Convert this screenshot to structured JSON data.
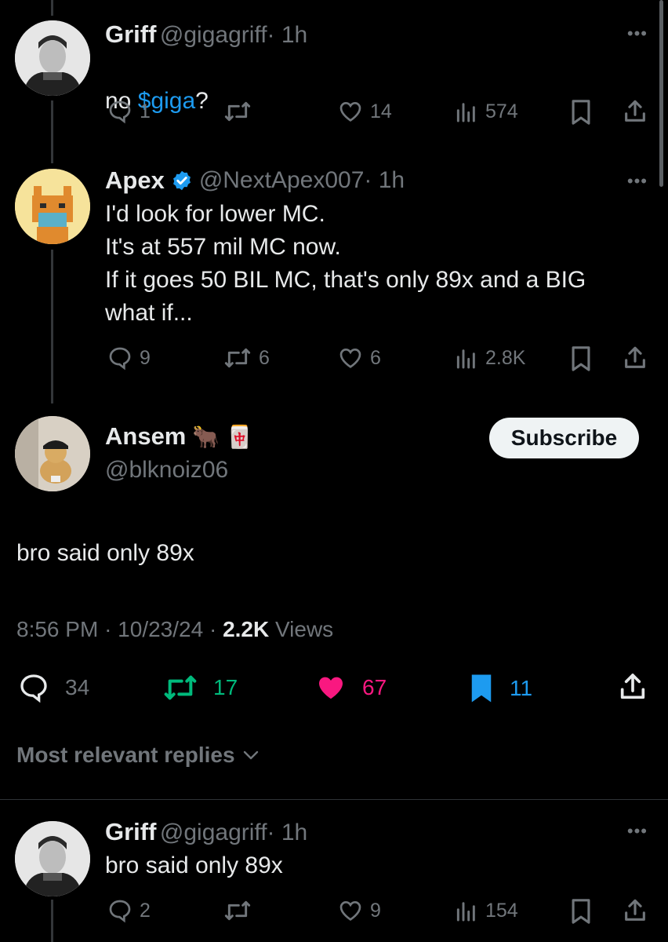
{
  "reply1": {
    "name": "Griff",
    "handle": "@gigagriff",
    "time": "· 1h",
    "text_prefix": "no ",
    "cashtag": "$giga",
    "text_suffix": "?",
    "reply_count": "1",
    "retweet_count": "",
    "like_count": "14",
    "view_count": "574"
  },
  "reply2": {
    "name": "Apex",
    "handle": "@NextApex007",
    "time": "· 1h",
    "text": "I'd look for lower MC.\nIt's at 557 mil MC now.\nIf it goes 50 BIL MC, that's only 89x and a BIG what if...",
    "reply_count": "9",
    "retweet_count": "6",
    "like_count": "6",
    "view_count": "2.8K"
  },
  "main_post": {
    "name": "Ansem",
    "name_emoji": "🐂",
    "name_emoji2": "🀄",
    "handle": "@blknoiz06",
    "subscribe_label": "Subscribe",
    "text": "bro said only 89x",
    "time": "8:56 PM",
    "date": "10/23/24",
    "views_count": "2.2K",
    "views_label": "Views",
    "sep1": "·",
    "sep2": "·",
    "reply_count": "34",
    "retweet_count": "17",
    "like_count": "67",
    "bookmark_count": "11"
  },
  "replies_sort_label": "Most relevant replies",
  "reply3": {
    "name": "Griff",
    "handle": "@gigagriff",
    "time": "· 1h",
    "text": "bro said only 89x",
    "reply_count": "2",
    "retweet_count": "",
    "like_count": "9",
    "view_count": "154"
  },
  "more_label": "•••",
  "colors": {
    "accent": "#1d9bf0",
    "like": "#f91880",
    "retweet": "#00ba7c",
    "muted": "#71767b",
    "verified": "#1d9bf0"
  }
}
